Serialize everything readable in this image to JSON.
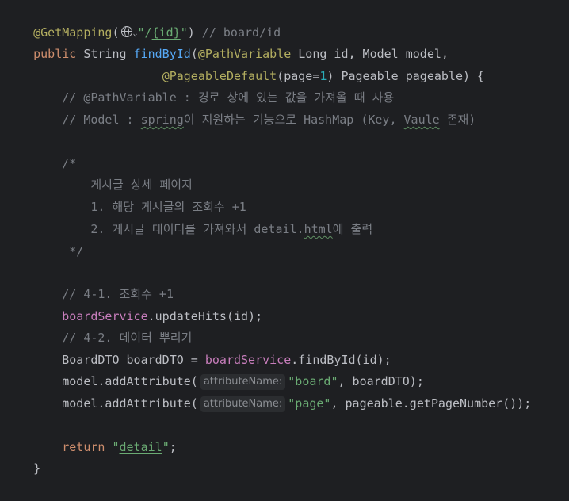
{
  "code": {
    "l1": {
      "ann": "@GetMapping",
      "p1": "(",
      "globe_icon": "globe-icon",
      "str_a": "\"/",
      "str_b": "{id}",
      "str_c": "\"",
      "p2": ")",
      "cmt": " // board/id"
    },
    "l2": {
      "kw": "public",
      "t1": " String ",
      "fn": "findById",
      "p1": "(",
      "ann": "@PathVariable",
      "t2": " Long id, Model model,"
    },
    "l3": {
      "indent": "                  ",
      "ann": "@PageableDefault",
      "p1": "(page=",
      "num": "1",
      "t2": ") Pageable pageable) {"
    },
    "l4": {
      "cmt": "    // @PathVariable : 경로 상에 있는 값을 가져올 때 사용"
    },
    "l5": {
      "cmt_a": "    // Model : ",
      "cmt_b": "spring",
      "cmt_c": "이 지원하는 기능으로 HashMap (Key, ",
      "cmt_d": "Vaule",
      "cmt_e": " 존재)"
    },
    "l7": {
      "cmt": "    /*"
    },
    "l8": {
      "cmt": "        게시글 상세 페이지"
    },
    "l9": {
      "cmt": "        1. 해당 게시글의 조회수 +1"
    },
    "l10": {
      "cmt_a": "        2. 게시글 데이터를 가져와서 detail.",
      "cmt_b": "html",
      "cmt_c": "에 출력"
    },
    "l11": {
      "cmt": "     */"
    },
    "l13": {
      "cmt": "    // 4-1. 조회수 +1"
    },
    "l14": {
      "indent": "    ",
      "fld": "boardService",
      "t": ".updateHits(id);"
    },
    "l15": {
      "cmt": "    // 4-2. 데이터 뿌리기"
    },
    "l16": {
      "t1": "    BoardDTO boardDTO = ",
      "fld": "boardService",
      "t2": ".findById(id);"
    },
    "l17": {
      "t1": "    model.addAttribute(",
      "hint": "attributeName:",
      "str": "\"board\"",
      "t2": ", boardDTO);"
    },
    "l18": {
      "t1": "    model.addAttribute(",
      "hint": "attributeName:",
      "str": "\"page\"",
      "t2": ", pageable.getPageNumber());"
    },
    "l20": {
      "indent": "    ",
      "kw": "return",
      "sp": " ",
      "str_a": "\"",
      "str_b": "detail",
      "str_c": "\"",
      "t": ";"
    },
    "l21": {
      "t": "}"
    }
  },
  "colors": {
    "background": "#1e1f22",
    "annotation": "#b3ae60",
    "keyword": "#cf8e6d",
    "function": "#56a8f5",
    "string": "#6aab73",
    "number": "#2aacb8",
    "comment": "#7a7e85",
    "field": "#c77dbb",
    "text": "#bcbec4"
  }
}
